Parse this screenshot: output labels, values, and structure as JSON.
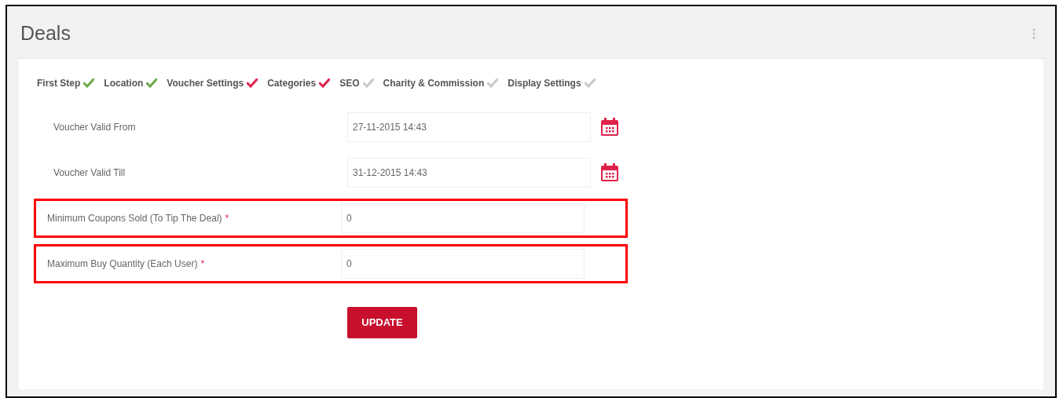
{
  "title": "Deals",
  "steps": [
    {
      "label": "First Step",
      "color": "#6aaa4a"
    },
    {
      "label": "Location",
      "color": "#6aaa4a"
    },
    {
      "label": "Voucher Settings",
      "color": "#e0224a"
    },
    {
      "label": "Categories",
      "color": "#e0224a"
    },
    {
      "label": "SEO",
      "color": "#c8c8c8"
    },
    {
      "label": "Charity & Commission",
      "color": "#c8c8c8"
    },
    {
      "label": "Display Settings",
      "color": "#c8c8c8"
    }
  ],
  "fields": [
    {
      "kind": "date",
      "label": "Voucher Valid From",
      "value": "27-11-2015 14:43",
      "highlighted": false
    },
    {
      "kind": "date",
      "label": "Voucher Valid Till",
      "value": "31-12-2015 14:43",
      "highlighted": false
    },
    {
      "kind": "text",
      "label": "Minimum Coupons Sold (To Tip The Deal)",
      "value": "0",
      "required_mark": "*",
      "highlighted": true
    },
    {
      "kind": "text",
      "label": "Maximum Buy Quantity (Each User)",
      "value": "0",
      "required_mark": "*",
      "highlighted": true
    }
  ],
  "button": "UPDATE"
}
